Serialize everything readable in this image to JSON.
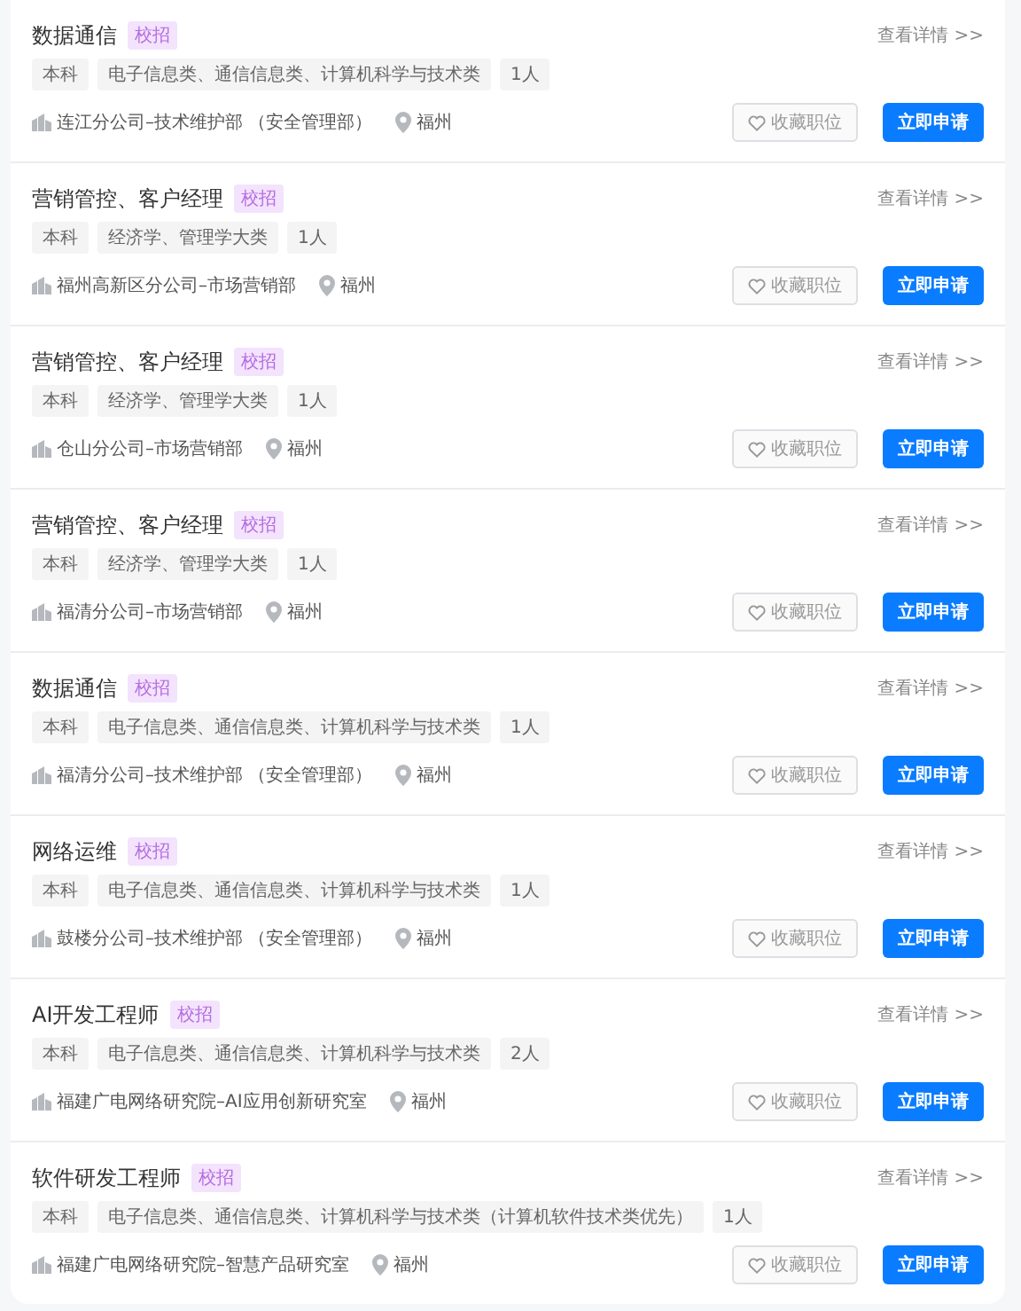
{
  "jobs": [
    {
      "title": "数据通信",
      "badge": "校招",
      "tags": [
        "本科",
        "电子信息类、通信信息类、计算机科学与技术类",
        "1人"
      ],
      "department": "连江分公司–技术维护部 （安全管理部）",
      "city": "福州",
      "details": "查看详情 >>",
      "favorite": "收藏职位",
      "apply": "立即申请"
    },
    {
      "title": "营销管控、客户经理",
      "badge": "校招",
      "tags": [
        "本科",
        "经济学、管理学大类",
        "1人"
      ],
      "department": "福州高新区分公司–市场营销部",
      "city": "福州",
      "details": "查看详情 >>",
      "favorite": "收藏职位",
      "apply": "立即申请"
    },
    {
      "title": "营销管控、客户经理",
      "badge": "校招",
      "tags": [
        "本科",
        "经济学、管理学大类",
        "1人"
      ],
      "department": "仓山分公司–市场营销部",
      "city": "福州",
      "details": "查看详情 >>",
      "favorite": "收藏职位",
      "apply": "立即申请"
    },
    {
      "title": "营销管控、客户经理",
      "badge": "校招",
      "tags": [
        "本科",
        "经济学、管理学大类",
        "1人"
      ],
      "department": "福清分公司–市场营销部",
      "city": "福州",
      "details": "查看详情 >>",
      "favorite": "收藏职位",
      "apply": "立即申请"
    },
    {
      "title": "数据通信",
      "badge": "校招",
      "tags": [
        "本科",
        "电子信息类、通信信息类、计算机科学与技术类",
        "1人"
      ],
      "department": "福清分公司–技术维护部 （安全管理部）",
      "city": "福州",
      "details": "查看详情 >>",
      "favorite": "收藏职位",
      "apply": "立即申请"
    },
    {
      "title": "网络运维",
      "badge": "校招",
      "tags": [
        "本科",
        "电子信息类、通信信息类、计算机科学与技术类",
        "1人"
      ],
      "department": "鼓楼分公司–技术维护部 （安全管理部）",
      "city": "福州",
      "details": "查看详情 >>",
      "favorite": "收藏职位",
      "apply": "立即申请"
    },
    {
      "title": "AI开发工程师",
      "badge": "校招",
      "tags": [
        "本科",
        "电子信息类、通信信息类、计算机科学与技术类",
        "2人"
      ],
      "department": "福建广电网络研究院–AI应用创新研究室",
      "city": "福州",
      "details": "查看详情 >>",
      "favorite": "收藏职位",
      "apply": "立即申请"
    },
    {
      "title": "软件研发工程师",
      "badge": "校招",
      "tags": [
        "本科",
        "电子信息类、通信信息类、计算机科学与技术类（计算机软件技术类优先）",
        "1人"
      ],
      "department": "福建广电网络研究院–智慧产品研究室",
      "city": "福州",
      "details": "查看详情 >>",
      "favorite": "收藏职位",
      "apply": "立即申请"
    }
  ]
}
